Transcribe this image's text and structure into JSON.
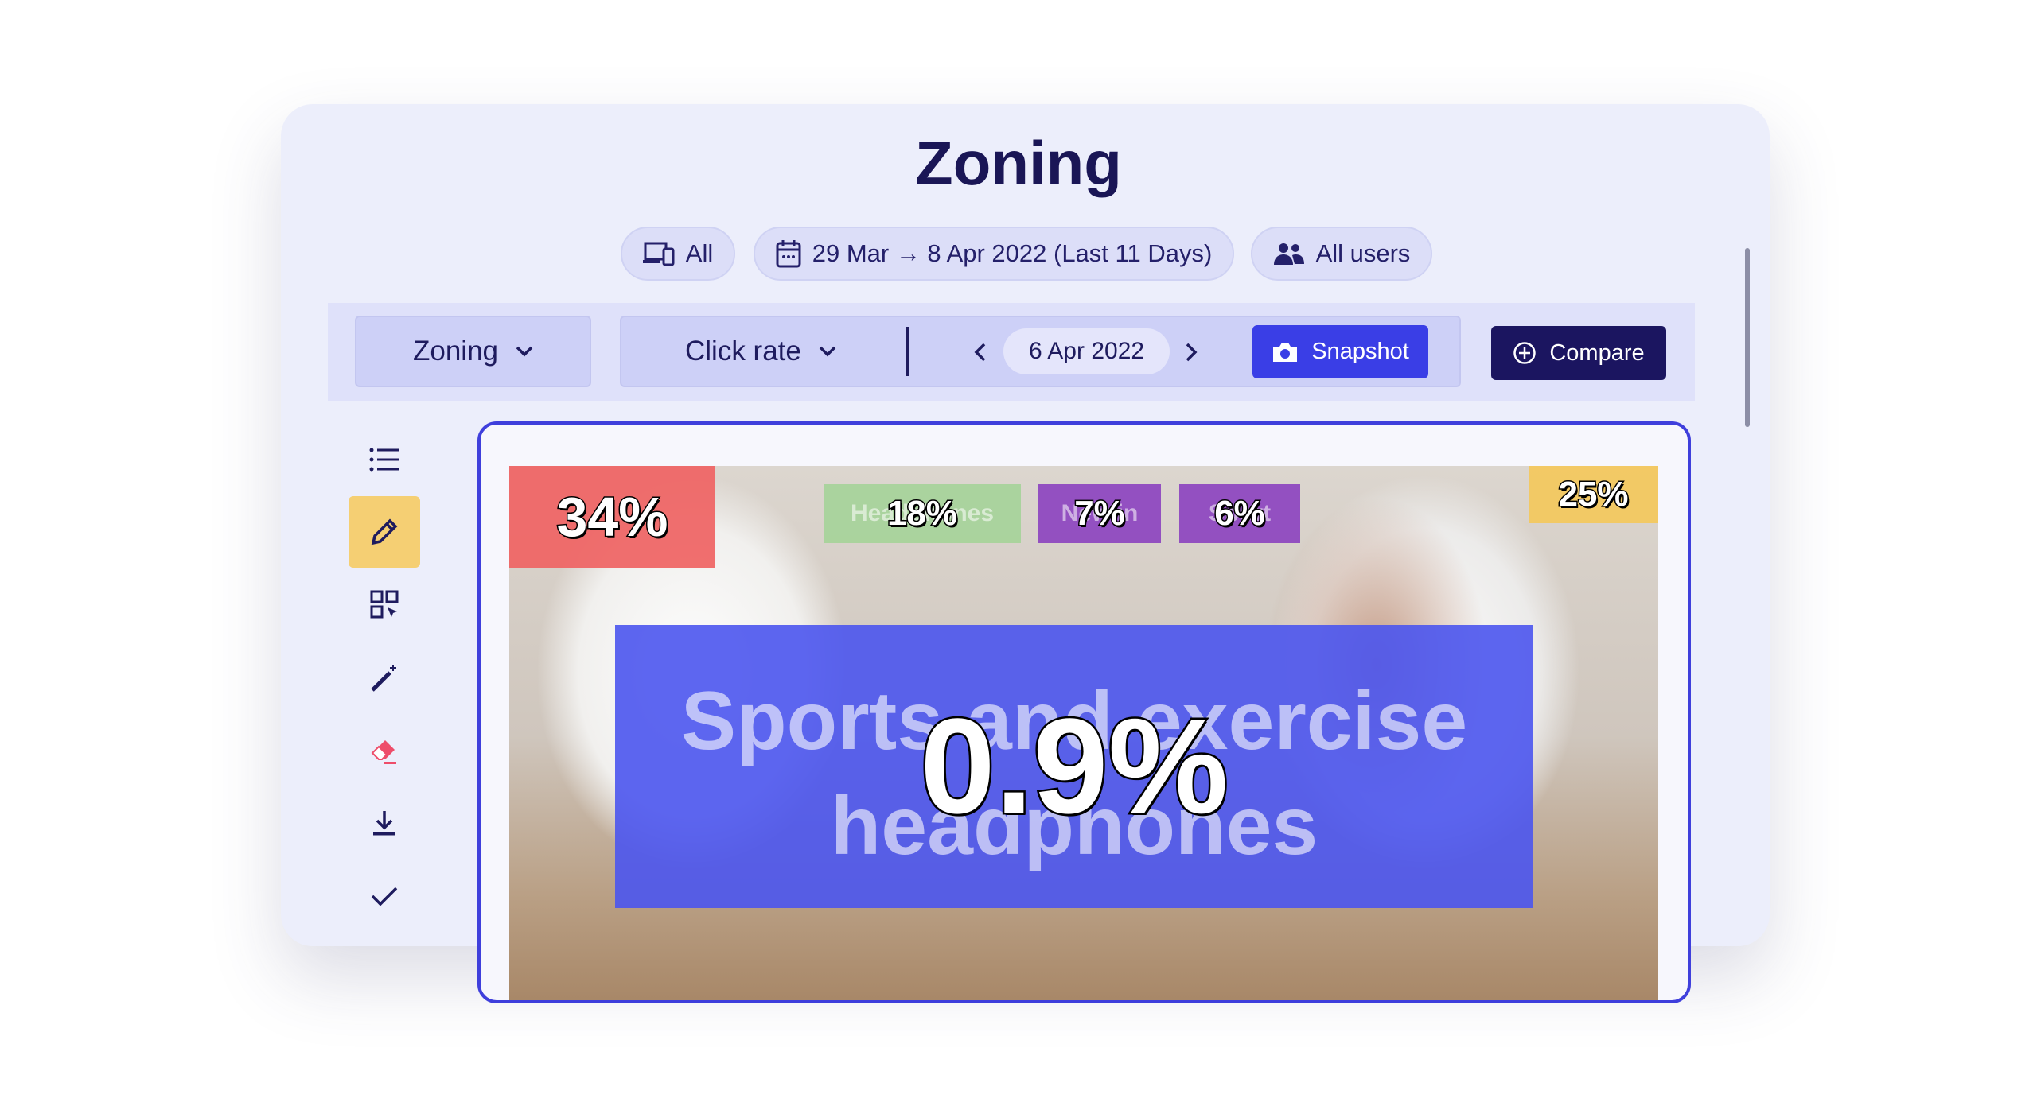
{
  "header": {
    "title": "Zoning"
  },
  "filters": {
    "device": "All",
    "date_range": "29 Mar → 8 Apr 2022 (Last 11 Days)",
    "segment": "All users"
  },
  "toolbar": {
    "view_select": "Zoning",
    "metric_select": "Click rate",
    "current_date": "6 Apr 2022",
    "snapshot_label": "Snapshot",
    "compare_label": "Compare",
    "snapshot_color": "#3a3ee6",
    "compare_color": "#1b1560"
  },
  "tools": [
    {
      "icon": "list-icon"
    },
    {
      "icon": "pencil-icon",
      "active": true
    },
    {
      "icon": "grid-select-icon"
    },
    {
      "icon": "magic-wand-icon"
    },
    {
      "icon": "eraser-icon"
    },
    {
      "icon": "download-icon"
    },
    {
      "icon": "check-icon"
    }
  ],
  "zones": [
    {
      "label": "",
      "value": "34%",
      "color": "#ef6b6b"
    },
    {
      "label": "Headphones",
      "value": "18%",
      "color": "#a6d39a"
    },
    {
      "label": "New in",
      "value": "7%",
      "color": "#8d46c0"
    },
    {
      "label": "Sport",
      "value": "6%",
      "color": "#8d46c0"
    },
    {
      "label": "",
      "value": "25%",
      "color": "#f3c85f"
    },
    {
      "label": "Sports and exercise headphones",
      "value": "0.9%",
      "color": "#4b55ee"
    }
  ]
}
